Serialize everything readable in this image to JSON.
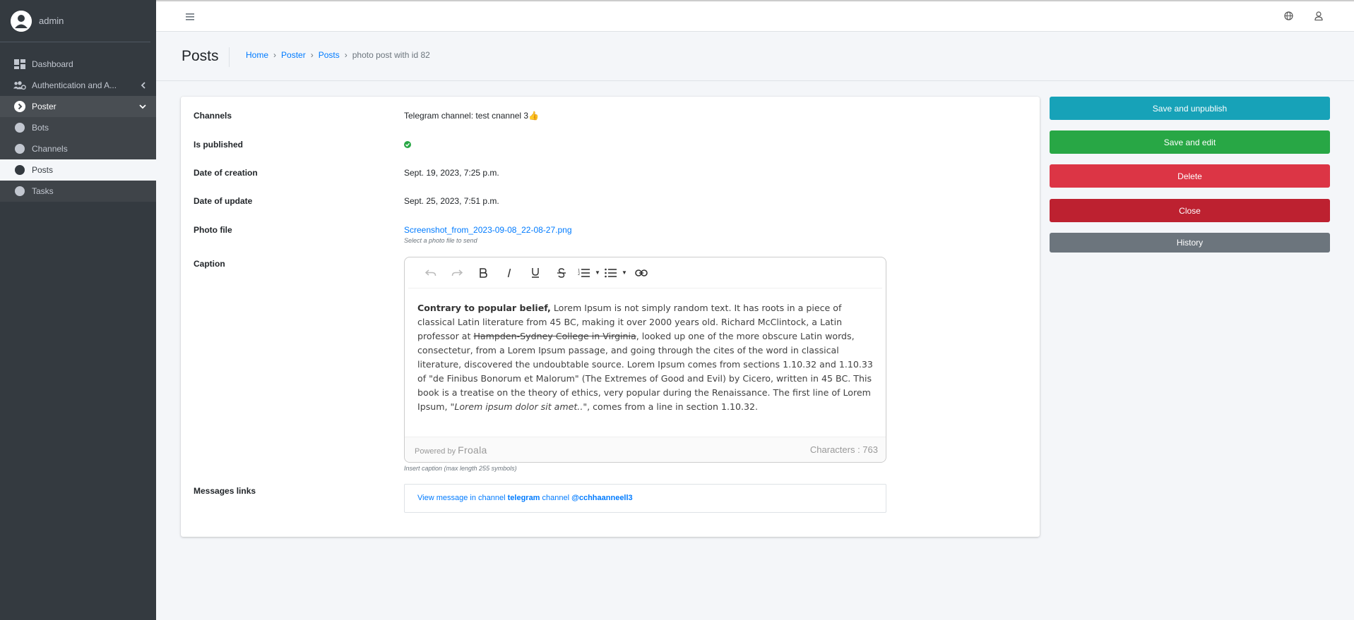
{
  "sidebar": {
    "user": "admin",
    "items": [
      {
        "label": "Dashboard",
        "icon": "dashboard-icon"
      },
      {
        "label": "Authentication and A...",
        "icon": "users-cog-icon"
      },
      {
        "label": "Poster",
        "icon": "chevron-circle-right-icon"
      },
      {
        "label": "Bots",
        "icon": "circle-icon"
      },
      {
        "label": "Channels",
        "icon": "circle-icon"
      },
      {
        "label": "Posts",
        "icon": "circle-icon"
      },
      {
        "label": "Tasks",
        "icon": "circle-icon"
      }
    ]
  },
  "header": {
    "title": "Posts",
    "breadcrumb": [
      "Home",
      "Poster",
      "Posts",
      "photo post with id 82"
    ]
  },
  "fields": {
    "channels_label": "Channels",
    "channels_value": "Telegram channel: test cnannel 3👍",
    "published_label": "Is published",
    "created_label": "Date of creation",
    "created_value": "Sept. 19, 2023, 7:25 p.m.",
    "updated_label": "Date of update",
    "updated_value": "Sept. 25, 2023, 7:51 p.m.",
    "photo_label": "Photo file",
    "photo_value": "Screenshot_from_2023-09-08_22-08-27.png",
    "photo_help": "Select a photo file to send",
    "caption_label": "Caption",
    "caption_help": "Insert caption (max length 255 symbols)",
    "messages_label": "Messages links"
  },
  "editor": {
    "bold_start": "Contrary to popular belief,",
    "text_1": " Lorem Ipsum is not simply random text. It has roots in a piece of classical Latin literature from 45 BC, making it over 2000 years old. Richard McClintock, a Latin professor at ",
    "strike": "Hampden-Sydney College in Virginia",
    "text_2": ", looked up one of the more obscure Latin words, consectetur, from a Lorem Ipsum passage, and going through the cites of the word in classical literature, discovered the undoubtable source. Lorem Ipsum comes from sections 1.10.32 and 1.10.33 of \"de Finibus Bonorum et Malorum\" (The Extremes of Good and Evil) by Cicero, written in 45 BC. This book is a treatise on the theory of ethics, very popular during the Renaissance. The first line of Lorem Ipsum, \"",
    "italic": "Lorem ipsum dolor sit amet..",
    "text_3": "\", comes from a line in section 1.10.32.",
    "powered_by": "Powered by",
    "brand": "Froala",
    "char_count": "Characters : 763"
  },
  "message_link": {
    "prefix": "View message in channel ",
    "bold1": "telegram",
    "middle": " channel ",
    "bold2": "@cchhaanneell3"
  },
  "buttons": {
    "save_unpublish": "Save and unpublish",
    "save_edit": "Save and edit",
    "delete": "Delete",
    "close": "Close",
    "history": "History"
  },
  "colors": {
    "info": "#17a2b8",
    "success": "#28a745",
    "danger": "#dc3545",
    "danger_dark": "#bd2130",
    "secondary": "#6c757d"
  }
}
